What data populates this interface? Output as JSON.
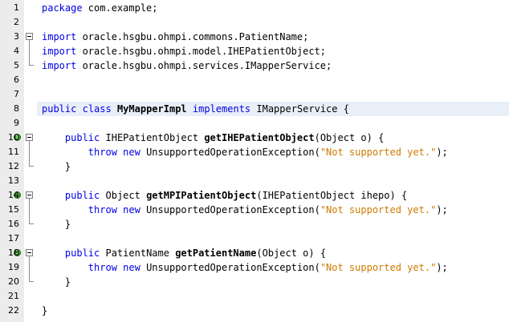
{
  "editor": {
    "lines": [
      {
        "num": "1",
        "segments": [
          {
            "t": "package",
            "c": "kw"
          },
          {
            "t": " com.example;"
          }
        ]
      },
      {
        "num": "2",
        "segments": []
      },
      {
        "num": "3",
        "fold": "start",
        "segments": [
          {
            "t": "import",
            "c": "kw"
          },
          {
            "t": " oracle.hsgbu.ohmpi.commons.PatientName;"
          }
        ]
      },
      {
        "num": "4",
        "fold": "mid",
        "segments": [
          {
            "t": "import",
            "c": "kw"
          },
          {
            "t": " oracle.hsgbu.ohmpi.model.IHEPatientObject;"
          }
        ]
      },
      {
        "num": "5",
        "fold": "end",
        "segments": [
          {
            "t": "import",
            "c": "kw"
          },
          {
            "t": " oracle.hsgbu.ohmpi.services.IMapperService;"
          }
        ]
      },
      {
        "num": "6",
        "segments": []
      },
      {
        "num": "7",
        "segments": []
      },
      {
        "num": "8",
        "current": true,
        "segments": [
          {
            "t": "public",
            "c": "kw"
          },
          {
            "t": " "
          },
          {
            "t": "class",
            "c": "kw"
          },
          {
            "t": " "
          },
          {
            "t": "MyMapperImpl",
            "c": "b"
          },
          {
            "t": " "
          },
          {
            "t": "implements",
            "c": "kw"
          },
          {
            "t": " IMapperService {"
          }
        ]
      },
      {
        "num": "9",
        "segments": []
      },
      {
        "num": "10",
        "annotation": "I",
        "fold": "start",
        "segments": [
          {
            "t": "    "
          },
          {
            "t": "public",
            "c": "kw"
          },
          {
            "t": " IHEPatientObject "
          },
          {
            "t": "getIHEPatientObject",
            "c": "b"
          },
          {
            "t": "(Object o) {"
          }
        ]
      },
      {
        "num": "11",
        "fold": "mid",
        "segments": [
          {
            "t": "        "
          },
          {
            "t": "throw",
            "c": "kw"
          },
          {
            "t": " "
          },
          {
            "t": "new",
            "c": "kw"
          },
          {
            "t": " UnsupportedOperationException("
          },
          {
            "t": "\"Not supported yet.\"",
            "c": "str"
          },
          {
            "t": ");"
          }
        ]
      },
      {
        "num": "12",
        "fold": "end",
        "segments": [
          {
            "t": "    }"
          }
        ]
      },
      {
        "num": "13",
        "segments": []
      },
      {
        "num": "14",
        "annotation": "I",
        "fold": "start",
        "segments": [
          {
            "t": "    "
          },
          {
            "t": "public",
            "c": "kw"
          },
          {
            "t": " Object "
          },
          {
            "t": "getMPIPatientObject",
            "c": "b"
          },
          {
            "t": "(IHEPatientObject ihepo) {"
          }
        ]
      },
      {
        "num": "15",
        "fold": "mid",
        "segments": [
          {
            "t": "        "
          },
          {
            "t": "throw",
            "c": "kw"
          },
          {
            "t": " "
          },
          {
            "t": "new",
            "c": "kw"
          },
          {
            "t": " UnsupportedOperationException("
          },
          {
            "t": "\"Not supported yet.\"",
            "c": "str"
          },
          {
            "t": ");"
          }
        ]
      },
      {
        "num": "16",
        "fold": "end",
        "segments": [
          {
            "t": "    }"
          }
        ]
      },
      {
        "num": "17",
        "segments": []
      },
      {
        "num": "18",
        "annotation": "I",
        "fold": "start",
        "segments": [
          {
            "t": "    "
          },
          {
            "t": "public",
            "c": "kw"
          },
          {
            "t": " PatientName "
          },
          {
            "t": "getPatientName",
            "c": "b"
          },
          {
            "t": "(Object o) {"
          }
        ]
      },
      {
        "num": "19",
        "fold": "mid",
        "segments": [
          {
            "t": "        "
          },
          {
            "t": "throw",
            "c": "kw"
          },
          {
            "t": " "
          },
          {
            "t": "new",
            "c": "kw"
          },
          {
            "t": " UnsupportedOperationException("
          },
          {
            "t": "\"Not supported yet.\"",
            "c": "str"
          },
          {
            "t": ");"
          }
        ]
      },
      {
        "num": "20",
        "fold": "end",
        "segments": [
          {
            "t": "    }"
          }
        ]
      },
      {
        "num": "21",
        "segments": []
      },
      {
        "num": "22",
        "segments": [
          {
            "t": "}"
          }
        ]
      }
    ]
  },
  "colors": {
    "keyword": "#0000e6",
    "string": "#ce7b00",
    "current_line": "#e9eff8",
    "gutter": "#ececec",
    "annotation": "#3a9a28"
  },
  "icons": {
    "annotation": "implements-method-icon",
    "fold": "fold-collapse-icon"
  }
}
